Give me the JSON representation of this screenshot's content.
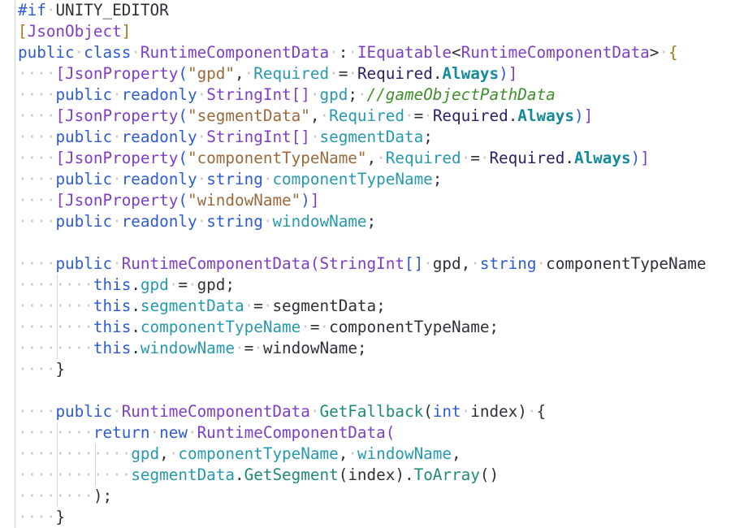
{
  "editor": {
    "language": "C#",
    "colors": {
      "background": "#ffffff",
      "keyword": "#2d5bd0",
      "type": "#7e3fc4",
      "string": "#9a6a3c",
      "field": "#2699ad",
      "enum_type": "#2a1f66",
      "enum_value": "#138b9a",
      "comment": "#3f8f2b",
      "method": "#1f8a76",
      "plain": "#303038"
    },
    "lines": [
      {
        "indent": 0,
        "tokens": [
          [
            "pre",
            "#if"
          ],
          [
            "ws",
            " "
          ],
          [
            "pln",
            "UNITY_EDITOR"
          ]
        ]
      },
      {
        "indent": 0,
        "tokens": [
          [
            "br1",
            "["
          ],
          [
            "type",
            "JsonObject"
          ],
          [
            "br1",
            "]"
          ]
        ]
      },
      {
        "indent": 0,
        "tokens": [
          [
            "kw",
            "public"
          ],
          [
            "ws",
            " "
          ],
          [
            "kw",
            "class"
          ],
          [
            "ws",
            " "
          ],
          [
            "type",
            "RuntimeComponentData"
          ],
          [
            "ws",
            " "
          ],
          [
            "pln",
            ":"
          ],
          [
            "ws",
            " "
          ],
          [
            "type",
            "IEquatable"
          ],
          [
            "pln",
            "<"
          ],
          [
            "type",
            "RuntimeComponentData"
          ],
          [
            "pln",
            ">"
          ],
          [
            "ws",
            " "
          ],
          [
            "br1",
            "{"
          ]
        ]
      },
      {
        "indent": 1,
        "tokens": [
          [
            "br2",
            "["
          ],
          [
            "type",
            "JsonProperty"
          ],
          [
            "br3",
            "("
          ],
          [
            "str",
            "\"gpd\""
          ],
          [
            "pln",
            ","
          ],
          [
            "ws",
            " "
          ],
          [
            "fld",
            "Required"
          ],
          [
            "ws",
            " "
          ],
          [
            "pln",
            "="
          ],
          [
            "ws",
            " "
          ],
          [
            "enm",
            "Required"
          ],
          [
            "pln",
            "."
          ],
          [
            "enmv",
            "Always"
          ],
          [
            "br3",
            ")"
          ],
          [
            "br2",
            "]"
          ]
        ]
      },
      {
        "indent": 1,
        "tokens": [
          [
            "kw",
            "public"
          ],
          [
            "ws",
            " "
          ],
          [
            "kw",
            "readonly"
          ],
          [
            "ws",
            " "
          ],
          [
            "type",
            "StringInt"
          ],
          [
            "br2",
            "[]"
          ],
          [
            "ws",
            " "
          ],
          [
            "fld",
            "gpd"
          ],
          [
            "pln",
            ";"
          ],
          [
            "ws",
            " "
          ],
          [
            "cmt",
            "//gameObjectPathData"
          ]
        ]
      },
      {
        "indent": 1,
        "tokens": [
          [
            "br2",
            "["
          ],
          [
            "type",
            "JsonProperty"
          ],
          [
            "br3",
            "("
          ],
          [
            "str",
            "\"segmentData\""
          ],
          [
            "pln",
            ","
          ],
          [
            "ws",
            " "
          ],
          [
            "fld",
            "Required"
          ],
          [
            "ws",
            " "
          ],
          [
            "pln",
            "="
          ],
          [
            "ws",
            " "
          ],
          [
            "enm",
            "Required"
          ],
          [
            "pln",
            "."
          ],
          [
            "enmv",
            "Always"
          ],
          [
            "br3",
            ")"
          ],
          [
            "br2",
            "]"
          ]
        ]
      },
      {
        "indent": 1,
        "tokens": [
          [
            "kw",
            "public"
          ],
          [
            "ws",
            " "
          ],
          [
            "kw",
            "readonly"
          ],
          [
            "ws",
            " "
          ],
          [
            "type",
            "StringInt"
          ],
          [
            "br2",
            "[]"
          ],
          [
            "ws",
            " "
          ],
          [
            "fld",
            "segmentData"
          ],
          [
            "pln",
            ";"
          ]
        ]
      },
      {
        "indent": 1,
        "tokens": [
          [
            "br2",
            "["
          ],
          [
            "type",
            "JsonProperty"
          ],
          [
            "br3",
            "("
          ],
          [
            "str",
            "\"componentTypeName\""
          ],
          [
            "pln",
            ","
          ],
          [
            "ws",
            " "
          ],
          [
            "fld",
            "Required"
          ],
          [
            "ws",
            " "
          ],
          [
            "pln",
            "="
          ],
          [
            "ws",
            " "
          ],
          [
            "enm",
            "Required"
          ],
          [
            "pln",
            "."
          ],
          [
            "enmv",
            "Always"
          ],
          [
            "br3",
            ")"
          ],
          [
            "br2",
            "]"
          ]
        ]
      },
      {
        "indent": 1,
        "tokens": [
          [
            "kw",
            "public"
          ],
          [
            "ws",
            " "
          ],
          [
            "kw",
            "readonly"
          ],
          [
            "ws",
            " "
          ],
          [
            "kw",
            "string"
          ],
          [
            "ws",
            " "
          ],
          [
            "fld",
            "componentTypeName"
          ],
          [
            "pln",
            ";"
          ]
        ]
      },
      {
        "indent": 1,
        "tokens": [
          [
            "br2",
            "["
          ],
          [
            "type",
            "JsonProperty"
          ],
          [
            "br3",
            "("
          ],
          [
            "str",
            "\"windowName\""
          ],
          [
            "br3",
            ")"
          ],
          [
            "br2",
            "]"
          ]
        ]
      },
      {
        "indent": 1,
        "tokens": [
          [
            "kw",
            "public"
          ],
          [
            "ws",
            " "
          ],
          [
            "kw",
            "readonly"
          ],
          [
            "ws",
            " "
          ],
          [
            "kw",
            "string"
          ],
          [
            "ws",
            " "
          ],
          [
            "fld",
            "windowName"
          ],
          [
            "pln",
            ";"
          ]
        ]
      },
      {
        "indent": 0,
        "tokens": []
      },
      {
        "indent": 1,
        "tokens": [
          [
            "kw",
            "public"
          ],
          [
            "ws",
            " "
          ],
          [
            "type",
            "RuntimeComponentData"
          ],
          [
            "br2",
            "("
          ],
          [
            "type",
            "StringInt"
          ],
          [
            "br3",
            "[]"
          ],
          [
            "ws",
            " "
          ],
          [
            "pln",
            "gpd"
          ],
          [
            "pln",
            ","
          ],
          [
            "ws",
            " "
          ],
          [
            "kw",
            "string"
          ],
          [
            "ws",
            " "
          ],
          [
            "pln",
            "componentTypeName"
          ]
        ]
      },
      {
        "indent": 2,
        "guides": [
          1
        ],
        "tokens": [
          [
            "kw",
            "this"
          ],
          [
            "pln",
            "."
          ],
          [
            "fld",
            "gpd"
          ],
          [
            "ws",
            " "
          ],
          [
            "pln",
            "="
          ],
          [
            "ws",
            " "
          ],
          [
            "pln",
            "gpd;"
          ]
        ]
      },
      {
        "indent": 2,
        "guides": [
          1
        ],
        "tokens": [
          [
            "kw",
            "this"
          ],
          [
            "pln",
            "."
          ],
          [
            "fld",
            "segmentData"
          ],
          [
            "ws",
            " "
          ],
          [
            "pln",
            "="
          ],
          [
            "ws",
            " "
          ],
          [
            "pln",
            "segmentData;"
          ]
        ]
      },
      {
        "indent": 2,
        "guides": [
          1
        ],
        "tokens": [
          [
            "kw",
            "this"
          ],
          [
            "pln",
            "."
          ],
          [
            "fld",
            "componentTypeName"
          ],
          [
            "ws",
            " "
          ],
          [
            "pln",
            "="
          ],
          [
            "ws",
            " "
          ],
          [
            "pln",
            "componentTypeName;"
          ]
        ]
      },
      {
        "indent": 2,
        "guides": [
          1
        ],
        "tokens": [
          [
            "kw",
            "this"
          ],
          [
            "pln",
            "."
          ],
          [
            "fld",
            "windowName"
          ],
          [
            "ws",
            " "
          ],
          [
            "pln",
            "="
          ],
          [
            "ws",
            " "
          ],
          [
            "pln",
            "windowName;"
          ]
        ]
      },
      {
        "indent": 1,
        "tokens": [
          [
            "br0",
            "}"
          ]
        ]
      },
      {
        "indent": 0,
        "tokens": []
      },
      {
        "indent": 1,
        "tokens": [
          [
            "kw",
            "public"
          ],
          [
            "ws",
            " "
          ],
          [
            "type",
            "RuntimeComponentData"
          ],
          [
            "ws",
            " "
          ],
          [
            "mth",
            "GetFallback"
          ],
          [
            "br0",
            "("
          ],
          [
            "kw",
            "int"
          ],
          [
            "ws",
            " "
          ],
          [
            "pln",
            "index"
          ],
          [
            "br0",
            ")"
          ],
          [
            "ws",
            " "
          ],
          [
            "br0",
            "{"
          ]
        ]
      },
      {
        "indent": 2,
        "guides": [
          1
        ],
        "tokens": [
          [
            "kw",
            "return"
          ],
          [
            "ws",
            " "
          ],
          [
            "kw",
            "new"
          ],
          [
            "ws",
            " "
          ],
          [
            "type",
            "RuntimeComponentData"
          ],
          [
            "br2",
            "("
          ]
        ]
      },
      {
        "indent": 3,
        "guides": [
          1,
          2
        ],
        "tokens": [
          [
            "fld",
            "gpd"
          ],
          [
            "pln",
            ","
          ],
          [
            "ws",
            " "
          ],
          [
            "fld",
            "componentTypeName"
          ],
          [
            "pln",
            ","
          ],
          [
            "ws",
            " "
          ],
          [
            "fld",
            "windowName"
          ],
          [
            "pln",
            ","
          ]
        ]
      },
      {
        "indent": 3,
        "guides": [
          1,
          2
        ],
        "tokens": [
          [
            "fld",
            "segmentData"
          ],
          [
            "pln",
            "."
          ],
          [
            "mth",
            "GetSegment"
          ],
          [
            "br0",
            "("
          ],
          [
            "pln",
            "index"
          ],
          [
            "br0",
            ")"
          ],
          [
            "pln",
            "."
          ],
          [
            "mth",
            "ToArray"
          ],
          [
            "br0",
            "()"
          ]
        ]
      },
      {
        "indent": 2,
        "guides": [
          1
        ],
        "tokens": [
          [
            "br0",
            ");"
          ]
        ]
      },
      {
        "indent": 1,
        "tokens": [
          [
            "br0",
            "}"
          ]
        ]
      }
    ]
  }
}
